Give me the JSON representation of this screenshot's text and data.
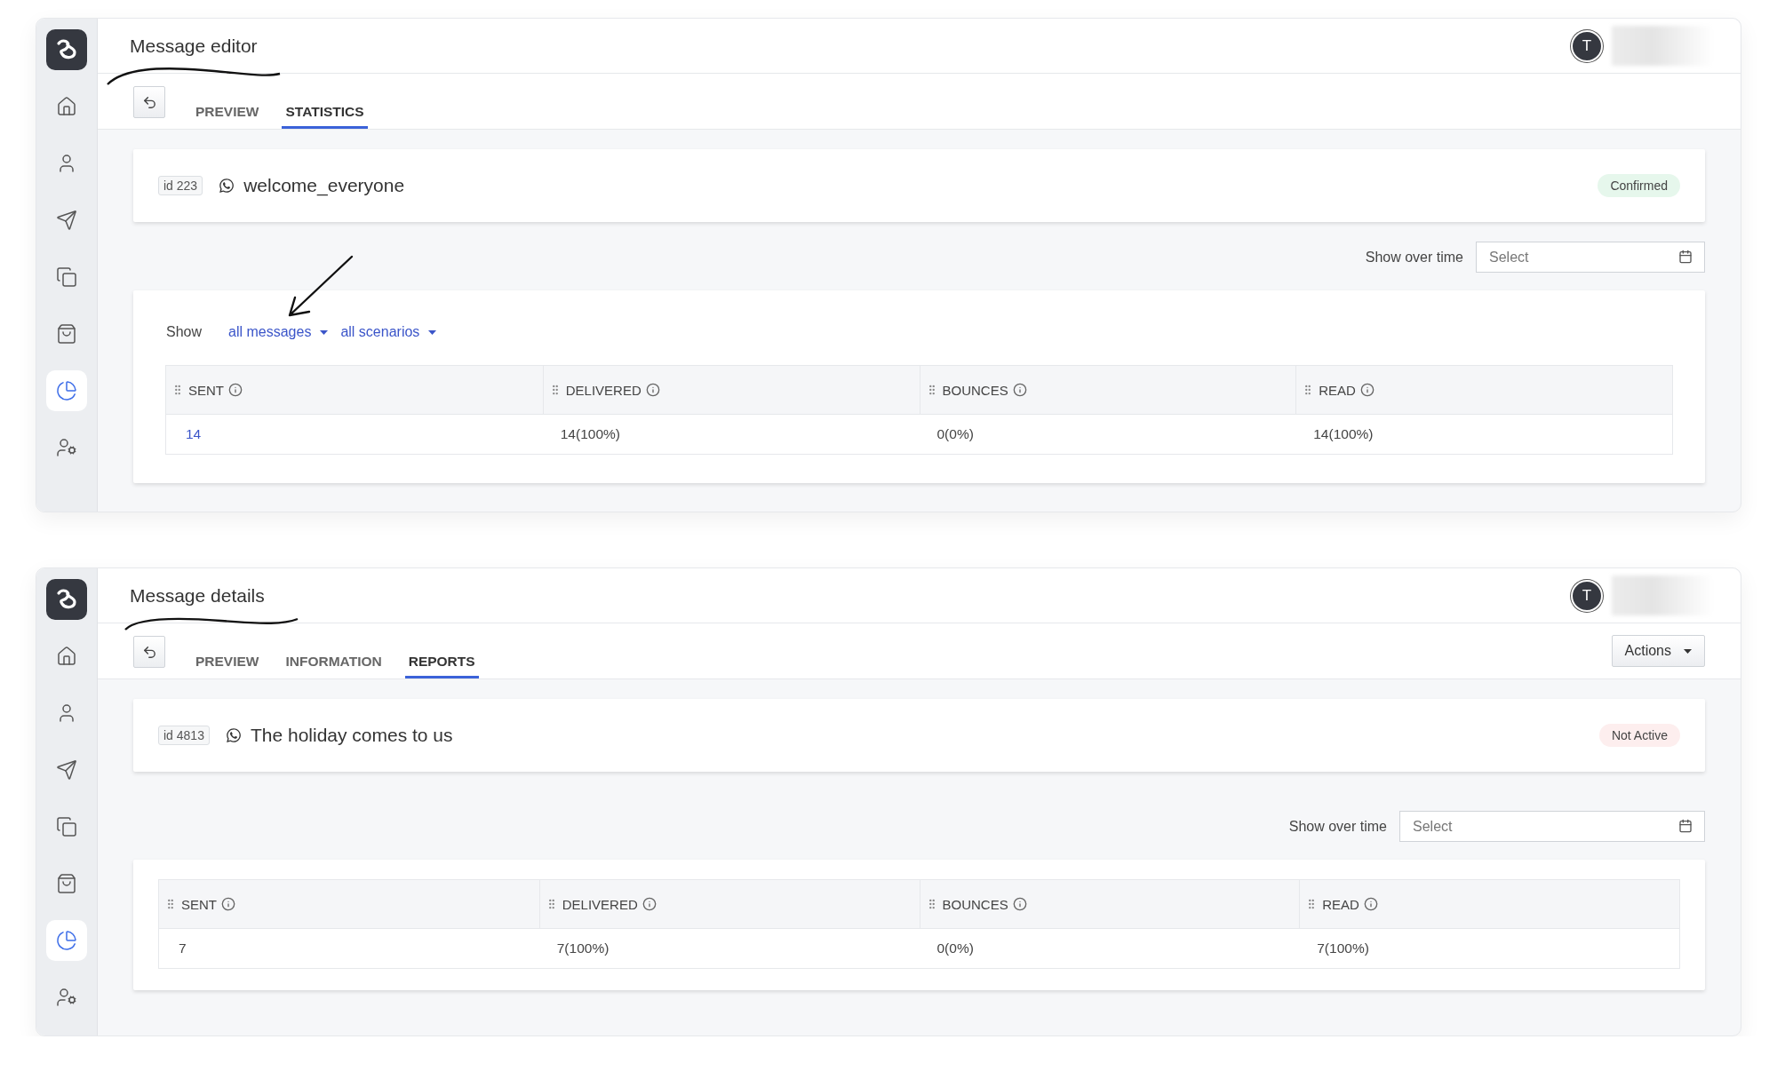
{
  "screens": [
    {
      "title": "Message editor",
      "avatar": "T",
      "sidebar": {
        "items": [
          {
            "selected": false
          },
          {
            "selected": false
          },
          {
            "selected": false
          },
          {
            "selected": false
          },
          {
            "selected": false
          },
          {
            "selected": true
          },
          {
            "selected": false
          }
        ]
      },
      "tabs": [
        {
          "label": "PREVIEW",
          "selected": false
        },
        {
          "label": "STATISTICS",
          "selected": true
        }
      ],
      "message": {
        "id": "id 223",
        "name": "welcome_everyone",
        "status": {
          "label": "Confirmed",
          "color": "#e6f7ec"
        }
      },
      "show_over_time": {
        "label": "Show over time",
        "placeholder": "Select"
      },
      "filters": {
        "label": "Show",
        "options": [
          "all messages",
          "all scenarios"
        ]
      },
      "table": {
        "columns": [
          "SENT",
          "DELIVERED",
          "BOUNCES",
          "READ"
        ],
        "rows": [
          [
            {
              "text": "14",
              "link": true
            },
            {
              "text": "14(100%)",
              "link": false
            },
            {
              "text": "0(0%)",
              "link": false
            },
            {
              "text": "14(100%)",
              "link": false
            }
          ]
        ]
      }
    },
    {
      "title": "Message details",
      "avatar": "T",
      "sidebar": {
        "items": [
          {
            "selected": false
          },
          {
            "selected": false
          },
          {
            "selected": false
          },
          {
            "selected": false
          },
          {
            "selected": false
          },
          {
            "selected": true
          },
          {
            "selected": false
          }
        ]
      },
      "tabs": [
        {
          "label": "PREVIEW",
          "selected": false
        },
        {
          "label": "INFORMATION",
          "selected": false
        },
        {
          "label": "REPORTS",
          "selected": true
        }
      ],
      "actions": "Actions",
      "message": {
        "id": "id 4813",
        "name": "The holiday comes to us",
        "status": {
          "label": "Not Active",
          "color": "#fdeeee"
        }
      },
      "show_over_time": {
        "label": "Show over time",
        "placeholder": "Select"
      },
      "table": {
        "columns": [
          "SENT",
          "DELIVERED",
          "BOUNCES",
          "READ"
        ],
        "rows": [
          [
            {
              "text": "7",
              "link": false
            },
            {
              "text": "7(100%)",
              "link": false
            },
            {
              "text": "0(0%)",
              "link": false
            },
            {
              "text": "7(100%)",
              "link": false
            }
          ]
        ]
      }
    }
  ]
}
